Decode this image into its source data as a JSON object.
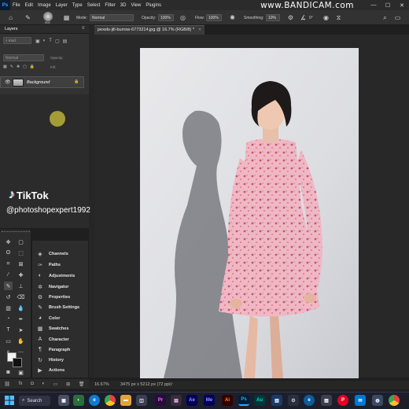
{
  "app": {
    "name": "Adobe Photoshop",
    "logo_text": "Ps"
  },
  "menu": [
    "File",
    "Edit",
    "Image",
    "Layer",
    "Type",
    "Select",
    "Filter",
    "3D",
    "View",
    "Plugins"
  ],
  "watermark": "www.BANDICAM.com",
  "options_bar": {
    "brush_size": "900",
    "mode_label": "Mode:",
    "mode_value": "Normal",
    "opacity_label": "Opacity:",
    "opacity_value": "100%",
    "flow_label": "Flow:",
    "flow_value": "100%",
    "smoothing_label": "Smoothing:",
    "smoothing_value": "10%",
    "angle_value": "0°"
  },
  "layers_panel": {
    "tab": "Layers",
    "filter_placeholder": "Kind",
    "blend_mode": "Normal",
    "opacity_label": "Opacity:",
    "fill_label": "Fill:",
    "layers": [
      {
        "name": "Background",
        "locked": true,
        "visible": true
      }
    ]
  },
  "tiktok": {
    "brand": "TikTok",
    "handle": "@photoshopexpert1992"
  },
  "document": {
    "tab_title": "pexels-jill-burrow-6773214.jpg @ 16.7% (RGB/8) *",
    "zoom": "16.67%",
    "dimensions": "3475 px x 5212 px (72 ppi)"
  },
  "panels": [
    {
      "label": "Channels",
      "icon": "channels-icon"
    },
    {
      "label": "Paths",
      "icon": "paths-icon"
    },
    {
      "label": "Adjustments",
      "icon": "adjustments-icon"
    },
    {
      "label": "Navigator",
      "icon": "navigator-icon"
    },
    {
      "label": "Properties",
      "icon": "properties-icon"
    },
    {
      "label": "Brush Settings",
      "icon": "brush-settings-icon"
    },
    {
      "label": "Color",
      "icon": "color-icon"
    },
    {
      "label": "Swatches",
      "icon": "swatches-icon"
    },
    {
      "label": "Character",
      "icon": "character-icon"
    },
    {
      "label": "Paragraph",
      "icon": "paragraph-icon"
    },
    {
      "label": "History",
      "icon": "history-icon"
    },
    {
      "label": "Actions",
      "icon": "actions-icon"
    }
  ],
  "taskbar": {
    "search_label": "Search",
    "apps": [
      "edge",
      "chrome",
      "premiere",
      "after-effects",
      "media-encoder",
      "illustrator",
      "photoshop",
      "audition",
      "edge-beta",
      "pinterest",
      "mail",
      "chrome-2"
    ]
  },
  "colors": {
    "accent": "#31a8ff",
    "panel_bg": "#323232",
    "canvas_bg": "#282828"
  }
}
